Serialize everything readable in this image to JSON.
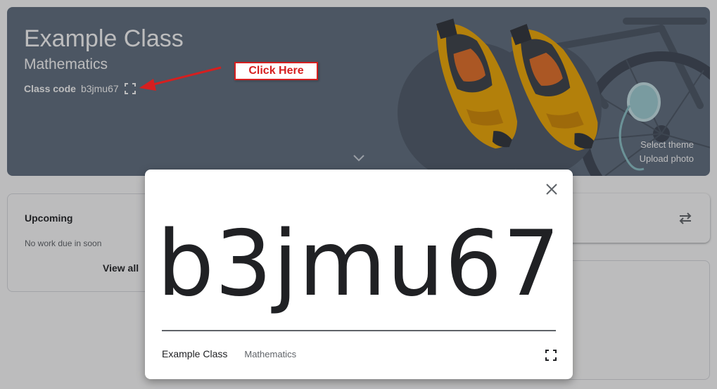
{
  "banner": {
    "class_title": "Example Class",
    "subject": "Mathematics",
    "class_code_label": "Class code",
    "class_code": "b3jmu67",
    "select_theme": "Select theme",
    "upload_photo": "Upload photo",
    "icons": {
      "expand": "fullscreen-icon",
      "chevron": "chevron-down-icon"
    },
    "colors": {
      "background": "#5f6d7e",
      "shoe_accent": "#f2a900"
    }
  },
  "upcoming": {
    "title": "Upcoming",
    "empty_text": "No work due in soon",
    "view_all": "View all"
  },
  "stream": {
    "icons": {
      "repost": "repost-icon"
    }
  },
  "modal": {
    "code": "b3jmu67",
    "class_name": "Example Class",
    "subject": "Mathematics",
    "icons": {
      "close": "close-icon",
      "fullscreen": "fullscreen-icon"
    }
  },
  "annotation": {
    "label": "Click Here",
    "color": "#d61f1f"
  }
}
